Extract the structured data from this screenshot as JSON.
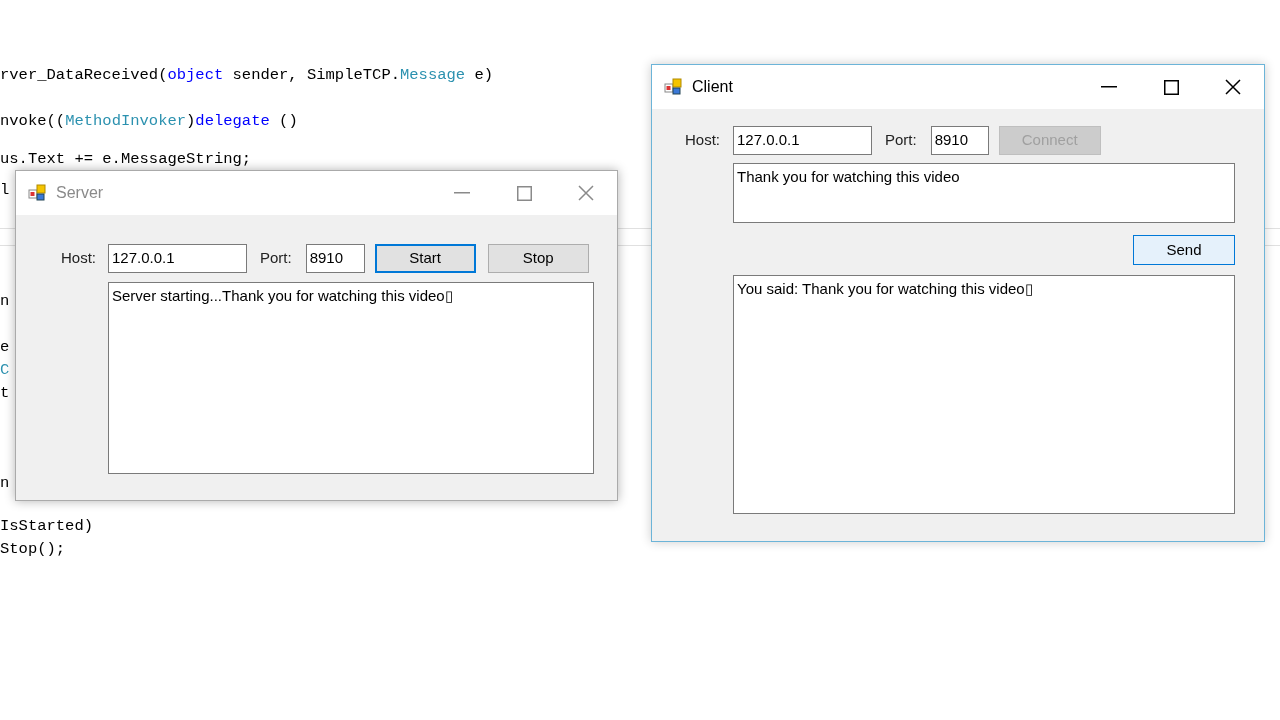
{
  "code_editor": {
    "lines": [
      {
        "segments": [
          {
            "kind": "plain",
            "text": "rver_DataReceived("
          },
          {
            "kind": "keyword",
            "text": "object"
          },
          {
            "kind": "plain",
            "text": " sender, SimpleTCP."
          },
          {
            "kind": "type",
            "text": "Message"
          },
          {
            "kind": "plain",
            "text": " e)"
          }
        ]
      },
      {
        "segments": [
          {
            "kind": "plain",
            "text": "nvoke(("
          },
          {
            "kind": "type",
            "text": "MethodInvoker"
          },
          {
            "kind": "plain",
            "text": ")"
          },
          {
            "kind": "keyword",
            "text": "delegate"
          },
          {
            "kind": "plain",
            "text": " ()"
          }
        ]
      },
      {
        "segments": [
          {
            "kind": "plain",
            "text": "us.Text += e.MessageString;"
          }
        ]
      },
      {
        "segments": [
          {
            "kind": "plain",
            "text": "l"
          }
        ]
      },
      {
        "segments": [
          {
            "kind": "plain",
            "text": "n"
          }
        ]
      },
      {
        "segments": [
          {
            "kind": "plain",
            "text": "e"
          }
        ]
      },
      {
        "segments": [
          {
            "kind": "type",
            "text": "C"
          }
        ]
      },
      {
        "segments": [
          {
            "kind": "plain",
            "text": "t"
          }
        ]
      },
      {
        "segments": [
          {
            "kind": "plain",
            "text": "n"
          }
        ]
      },
      {
        "segments": [
          {
            "kind": "plain",
            "text": "IsStarted)"
          }
        ]
      },
      {
        "segments": [
          {
            "kind": "plain",
            "text": "Stop();"
          }
        ]
      }
    ]
  },
  "server_window": {
    "title": "Server",
    "active": false,
    "host_label": "Host:",
    "host": "127.0.0.1",
    "port_label": "Port:",
    "port": "8910",
    "buttons": [
      {
        "label": "Start",
        "focused": true,
        "disabled": false
      },
      {
        "label": "Stop",
        "focused": false,
        "disabled": false
      }
    ],
    "log": "Server starting...Thank you for watching this video▯"
  },
  "client_window": {
    "title": "Client",
    "active": true,
    "host_label": "Host:",
    "host": "127.0.0.1",
    "port_label": "Port:",
    "port": "8910",
    "connect_button": {
      "label": "Connect",
      "disabled": true
    },
    "message": "Thank you for watching this video",
    "send_button": {
      "label": "Send",
      "focused": true,
      "disabled": false
    },
    "log": "You said: Thank you for watching this video▯"
  }
}
